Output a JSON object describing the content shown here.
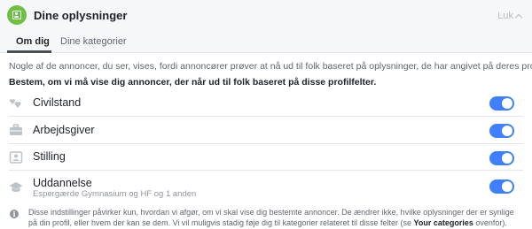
{
  "header": {
    "title": "Dine oplysninger",
    "close_label": "Luk",
    "accent_color": "#6fbf45"
  },
  "tabs": [
    {
      "label": "Om dig",
      "active": true
    },
    {
      "label": "Dine kategorier",
      "active": false
    }
  ],
  "intro_text": "Nogle af de annoncer, du ser, vises, fordi annoncører prøver at nå ud til folk baseret på oplysninger, de har angivet på deres profiler.",
  "prompt_text": "Bestem, om vi må vise dig annoncer, der når ud til folk baseret på disse profilfelter.",
  "fields": [
    {
      "label": "Civilstand",
      "icon": "hearts-icon",
      "enabled": true
    },
    {
      "label": "Arbejdsgiver",
      "icon": "briefcase-icon",
      "enabled": true
    },
    {
      "label": "Stilling",
      "icon": "id-badge-icon",
      "enabled": true
    },
    {
      "label": "Uddannelse",
      "sublabel": "Espergærde Gymnasium og HF og 1 anden",
      "icon": "graduation-cap-icon",
      "enabled": true
    }
  ],
  "footer": {
    "text_before": "Disse indstillinger påvirker kun, hvordan vi afgør, om vi skal vise dig bestemte annoncer. De ændrer ikke, hvilke oplysninger der er synlige på din profil, eller hvem der kan se dem. Vi vil muligvis stadig føje dig til kategorier relateret til disse felter (se ",
    "link_text": "Your categories",
    "text_after": " ovenfor).",
    "icon": "info-icon"
  },
  "colors": {
    "toggle_on": "#4080ff",
    "divider": "#e5e6e9",
    "muted_text": "#606770"
  }
}
